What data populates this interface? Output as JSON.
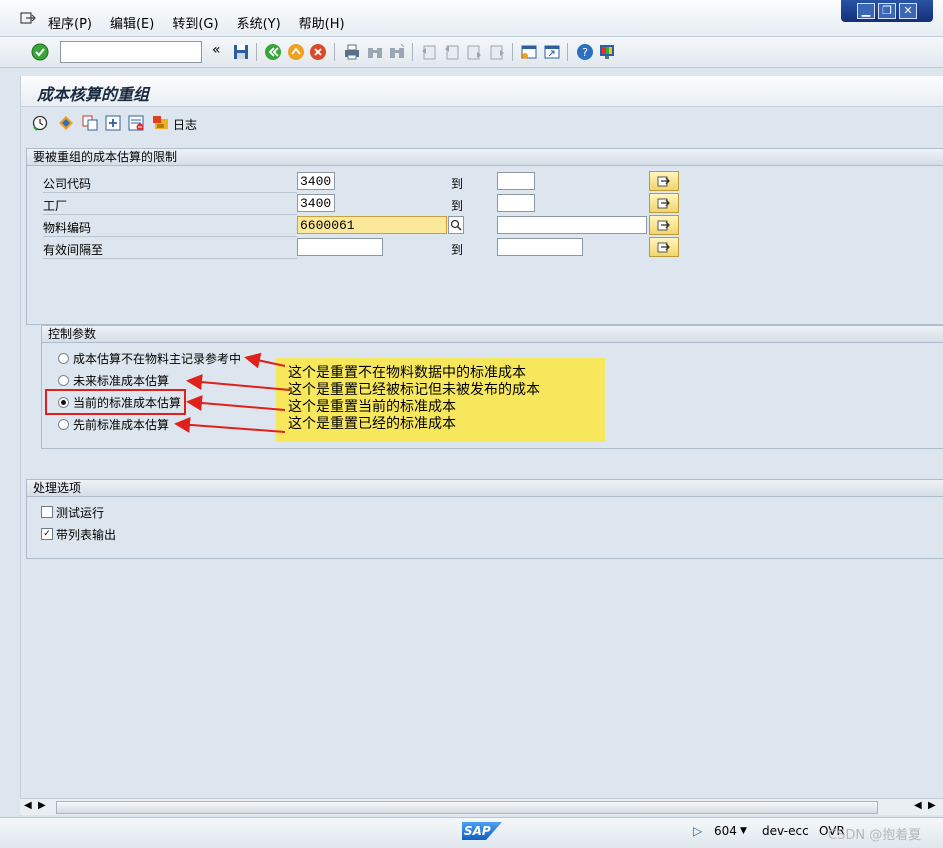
{
  "menubar": {
    "items": [
      "程序(P)",
      "编辑(E)",
      "转到(G)",
      "系统(Y)",
      "帮助(H)"
    ]
  },
  "window_controls": {
    "minimize": "▁",
    "restore": "❐",
    "close": "✕"
  },
  "toolbar": {
    "command_field_value": "",
    "back_symbol": "«"
  },
  "screen": {
    "title": "成本核算的重组",
    "log_label": "日志"
  },
  "restrictions": {
    "header": "要被重组的成本估算的限制",
    "to_label": "到",
    "rows": [
      {
        "label": "公司代码",
        "from": "3400",
        "to": ""
      },
      {
        "label": "工厂",
        "from": "3400",
        "to": ""
      },
      {
        "label": "物料编码",
        "from": "6600061",
        "to": ""
      },
      {
        "label": "有效间隔至",
        "from": "",
        "to": ""
      }
    ]
  },
  "control_params": {
    "header": "控制参数",
    "options": [
      {
        "label": "成本估算不在物料主记录参考中",
        "selected": false
      },
      {
        "label": "未来标准成本估算",
        "selected": false
      },
      {
        "label": "当前的标准成本估算",
        "selected": true
      },
      {
        "label": "先前标准成本估算",
        "selected": false
      }
    ]
  },
  "annotation": {
    "lines": [
      "这个是重置不在物料数据中的标准成本",
      "这个是重置已经被标记但未被发布的成本",
      "这个是重置当前的标准成本",
      "这个是重置已经的标准成本"
    ]
  },
  "processing": {
    "header": "处理选项",
    "options": [
      {
        "label": "测试运行",
        "checked": false
      },
      {
        "label": "带列表输出",
        "checked": true
      }
    ]
  },
  "statusbar": {
    "sap_logo": "SAP",
    "client": "604",
    "server": "dev-ecc",
    "mode": "OVR",
    "watermark": "CSDN @抱着夏"
  },
  "colors": {
    "annotation_bg": "#f7e75c",
    "arrow_red": "#e0201a",
    "focus_field": "#fbe89a"
  }
}
